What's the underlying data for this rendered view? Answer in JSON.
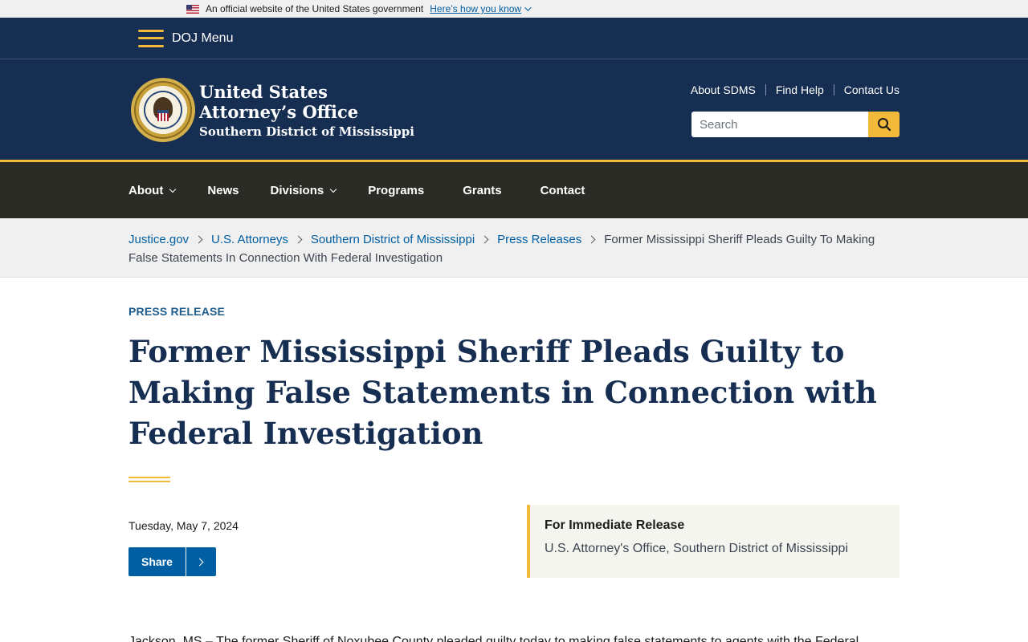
{
  "gov_banner": {
    "text": "An official website of the United States government",
    "link": "Here’s how you know"
  },
  "menu": {
    "label": "DOJ Menu"
  },
  "header": {
    "brand_line1": "United States",
    "brand_line2": "Attorney’s Office",
    "brand_line3": "Southern District of Mississippi",
    "util_links": [
      "About SDMS",
      "Find Help",
      "Contact Us"
    ],
    "search_placeholder": "Search"
  },
  "nav": {
    "items": [
      "About",
      "News",
      "Divisions",
      "Programs",
      "Grants",
      "Contact"
    ]
  },
  "breadcrumb": {
    "links": [
      "Justice.gov",
      "U.S. Attorneys",
      "Southern District of Mississippi",
      "Press Releases"
    ],
    "current": "Former Mississippi Sheriff Pleads Guilty To Making False Statements In Connection With Federal Investigation"
  },
  "article": {
    "eyebrow": "PRESS RELEASE",
    "title": "Former Mississippi Sheriff Pleads Guilty to Making False Statements in Connection with Federal Investigation",
    "date": "Tuesday, May 7, 2024",
    "share_label": "Share",
    "release_title": "For Immediate Release",
    "release_office": "U.S. Attorney's Office, Southern District of Mississippi",
    "body_start": "Jackson, MS – The former Sheriff of Noxubee County pleaded guilty today to making false statements to agents with the Federal"
  },
  "colors": {
    "navy": "#162e51",
    "gold": "#f2b93b",
    "nav_dark": "#2b2b26",
    "link_blue": "#005ea2"
  }
}
